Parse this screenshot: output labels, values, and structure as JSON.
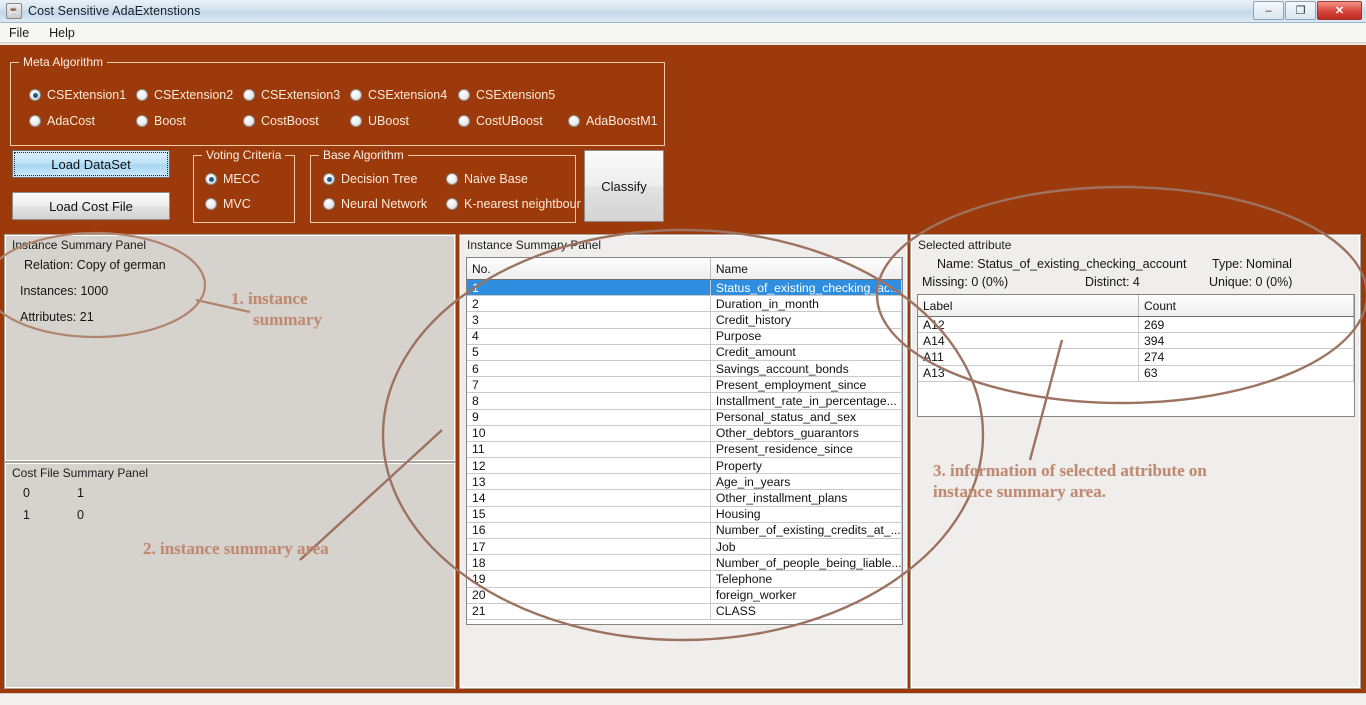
{
  "window": {
    "title": "Cost Sensitive AdaExtenstions",
    "icon": "java-cup-icon",
    "minimize": "–",
    "restore": "❐",
    "close": "✕"
  },
  "menubar": {
    "items": [
      "File",
      "Help"
    ]
  },
  "meta_algorithm": {
    "title": "Meta Algorithm",
    "options": [
      {
        "label": "CSExtension1",
        "selected": true
      },
      {
        "label": "CSExtension2",
        "selected": false
      },
      {
        "label": "CSExtension3",
        "selected": false
      },
      {
        "label": "CSExtension4",
        "selected": false
      },
      {
        "label": "CSExtension5",
        "selected": false
      },
      {
        "label": "AdaCost",
        "selected": false
      },
      {
        "label": "Boost",
        "selected": false
      },
      {
        "label": "CostBoost",
        "selected": false
      },
      {
        "label": "UBoost",
        "selected": false
      },
      {
        "label": "CostUBoost",
        "selected": false
      },
      {
        "label": "AdaBoostM1",
        "selected": false
      }
    ]
  },
  "buttons": {
    "load_dataset": "Load DataSet",
    "load_cost_file": "Load Cost File",
    "classify": "Classify"
  },
  "voting_criteria": {
    "title": "Voting Criteria",
    "options": [
      {
        "label": "MECC",
        "selected": true
      },
      {
        "label": "MVC",
        "selected": false
      }
    ]
  },
  "base_algorithm": {
    "title": "Base Algorithm",
    "options": [
      {
        "label": "Decision Tree",
        "selected": true
      },
      {
        "label": "Naive Base",
        "selected": false
      },
      {
        "label": "Neural Network",
        "selected": false
      },
      {
        "label": "K-nearest neightbour",
        "selected": false
      }
    ]
  },
  "instance_summary": {
    "title": "Instance Summary Panel",
    "relation": "Relation: Copy of german",
    "instances": "Instances: 1000",
    "attributes": "Attributes: 21"
  },
  "cost_file_summary": {
    "title": "Cost File Summary Panel",
    "matrix": [
      [
        "0",
        "1"
      ],
      [
        "1",
        "0"
      ]
    ]
  },
  "attribute_list": {
    "title": "Instance Summary Panel",
    "columns": [
      "No.",
      "Name"
    ],
    "rows": [
      {
        "no": "1",
        "name": "Status_of_existing_checking_ac...",
        "selected": true
      },
      {
        "no": "2",
        "name": "Duration_in_month",
        "selected": false
      },
      {
        "no": "3",
        "name": "Credit_history",
        "selected": false
      },
      {
        "no": "4",
        "name": "Purpose",
        "selected": false
      },
      {
        "no": "5",
        "name": "Credit_amount",
        "selected": false
      },
      {
        "no": "6",
        "name": "Savings_account_bonds",
        "selected": false
      },
      {
        "no": "7",
        "name": "Present_employment_since",
        "selected": false
      },
      {
        "no": "8",
        "name": "Installment_rate_in_percentage...",
        "selected": false
      },
      {
        "no": "9",
        "name": "Personal_status_and_sex",
        "selected": false
      },
      {
        "no": "10",
        "name": "Other_debtors_guarantors",
        "selected": false
      },
      {
        "no": "11",
        "name": "Present_residence_since",
        "selected": false
      },
      {
        "no": "12",
        "name": "Property",
        "selected": false
      },
      {
        "no": "13",
        "name": "Age_in_years",
        "selected": false
      },
      {
        "no": "14",
        "name": "Other_installment_plans",
        "selected": false
      },
      {
        "no": "15",
        "name": "Housing",
        "selected": false
      },
      {
        "no": "16",
        "name": "Number_of_existing_credits_at_...",
        "selected": false
      },
      {
        "no": "17",
        "name": "Job",
        "selected": false
      },
      {
        "no": "18",
        "name": "Number_of_people_being_liable...",
        "selected": false
      },
      {
        "no": "19",
        "name": "Telephone",
        "selected": false
      },
      {
        "no": "20",
        "name": "foreign_worker",
        "selected": false
      },
      {
        "no": "21",
        "name": "CLASS",
        "selected": false
      }
    ]
  },
  "selected_attribute": {
    "title": "Selected attribute",
    "name": "Name: Status_of_existing_checking_account",
    "type": "Type: Nominal",
    "missing": "Missing: 0 (0%)",
    "distinct": "Distinct: 4",
    "unique": "Unique: 0 (0%)",
    "columns": [
      "Label",
      "Count"
    ],
    "rows": [
      {
        "label": "A12",
        "count": "269"
      },
      {
        "label": "A14",
        "count": "394"
      },
      {
        "label": "A11",
        "count": "274"
      },
      {
        "label": "A13",
        "count": "63"
      }
    ]
  },
  "annotations": {
    "color": "#c08a72",
    "one_line1": "1. instance",
    "one_line2": "summary",
    "two": "2. instance summary area",
    "three_line1": "3. information of selected attribute on",
    "three_line2": "instance summary area."
  }
}
